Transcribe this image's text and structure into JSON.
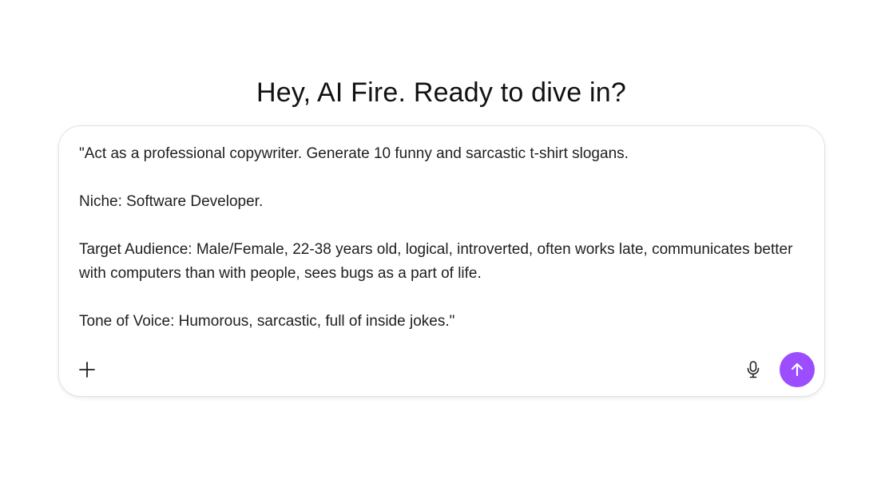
{
  "greeting": "Hey, AI Fire. Ready to dive in?",
  "composer": {
    "lines": [
      "\"Act as a professional copywriter. Generate 10 funny and sarcastic t-shirt slogans.",
      "Niche: Software Developer.",
      "Target Audience: Male/Female, 22-38 years old, logical, introverted, often works late, communicates better with computers than with people, sees bugs as a part of life.",
      "Tone of Voice: Humorous, sarcastic, full of inside jokes.\""
    ],
    "icons": {
      "add": "plus-icon",
      "mic": "microphone-icon",
      "send": "arrow-up-icon"
    },
    "send_button_color": "#9b4dff"
  }
}
